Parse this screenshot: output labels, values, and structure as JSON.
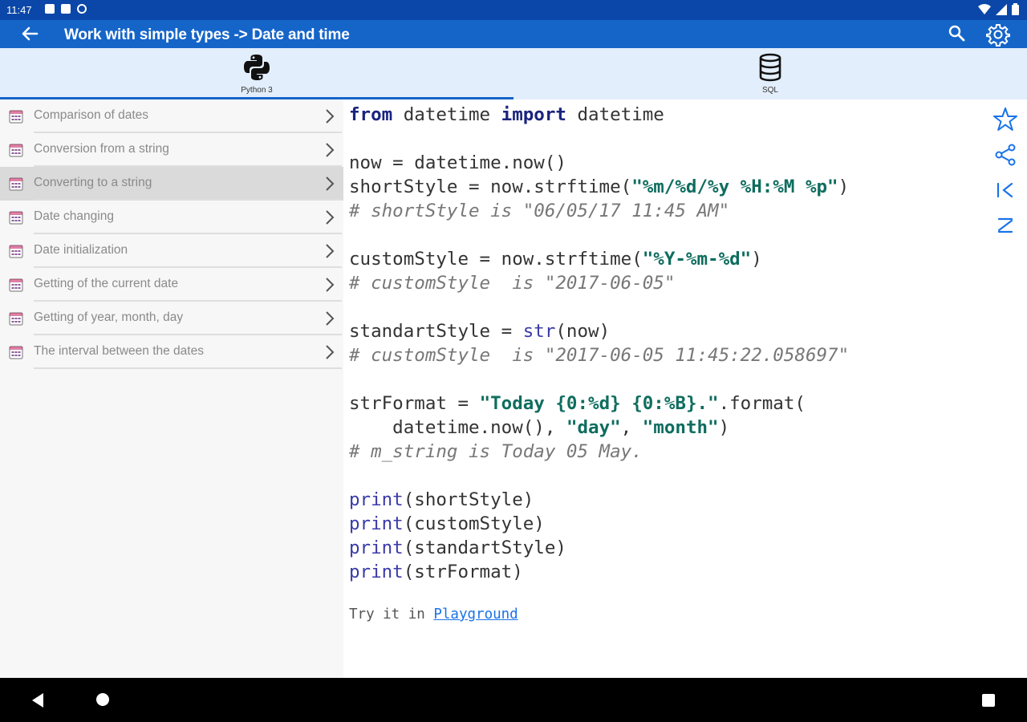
{
  "status_bar": {
    "time": "11:47",
    "left_icons": [
      "notification-icon",
      "sd-card-icon",
      "sync-icon"
    ],
    "right_icons": [
      "wifi-icon",
      "signal-icon",
      "battery-icon"
    ]
  },
  "app_bar": {
    "title": "Work with simple types -> Date and time",
    "back_icon": "arrow-back-icon",
    "search_icon": "search-icon",
    "settings_icon": "gear-icon"
  },
  "tabs": [
    {
      "label": "Python 3",
      "icon": "python-icon",
      "active": true
    },
    {
      "label": "SQL",
      "icon": "database-icon",
      "active": false
    }
  ],
  "sidebar": {
    "items": [
      {
        "label": "Comparison of dates"
      },
      {
        "label": "Conversion from a string"
      },
      {
        "label": "Converting to a string",
        "selected": true
      },
      {
        "label": "Date changing"
      },
      {
        "label": "Date initialization"
      },
      {
        "label": "Getting of the current date"
      },
      {
        "label": "Getting of year, month, day"
      },
      {
        "label": "The interval between the dates"
      }
    ]
  },
  "code": {
    "line1_kw1": "from",
    "line1_mod": " datetime ",
    "line1_kw2": "import",
    "line1_name": " datetime",
    "line3": "now = datetime.now()",
    "line4_a": "shortStyle = now.strftime(",
    "line4_s": "\"%m/%d/%y %H:%M %p\"",
    "line4_b": ")",
    "line5": "# shortStyle is \"06/05/17 11:45 AM\"",
    "line7_a": "customStyle = now.strftime(",
    "line7_s": "\"%Y-%m-%d\"",
    "line7_b": ")",
    "line8": "# customStyle  is \"2017-06-05\"",
    "line10_a": "standartStyle = ",
    "line10_f": "str",
    "line10_b": "(now)",
    "line11": "# customStyle  is \"2017-06-05 11:45:22.058697\"",
    "line13_a": "strFormat = ",
    "line13_s": "\"Today {0:%d} {0:%B}.\"",
    "line13_b": ".format(",
    "line14_a": "    datetime.now(), ",
    "line14_s1": "\"day\"",
    "line14_c": ", ",
    "line14_s2": "\"month\"",
    "line14_b": ")",
    "line15": "# m_string is Today 05 May.",
    "print_kw": "print",
    "line17_arg": "(shortStyle)",
    "line18_arg": "(customStyle)",
    "line19_arg": "(standartStyle)",
    "line20_arg": "(strFormat)"
  },
  "try_it": {
    "prefix": "Try it in ",
    "link": "Playground"
  },
  "side_actions": [
    "star-icon",
    "share-icon",
    "first-icon",
    "last-icon"
  ],
  "colors": {
    "accent": "#1565c9",
    "status_bar": "#0a47a8",
    "tab_bg": "#e3eefc",
    "string": "#0f6d5f",
    "keyword": "#1a237e"
  }
}
